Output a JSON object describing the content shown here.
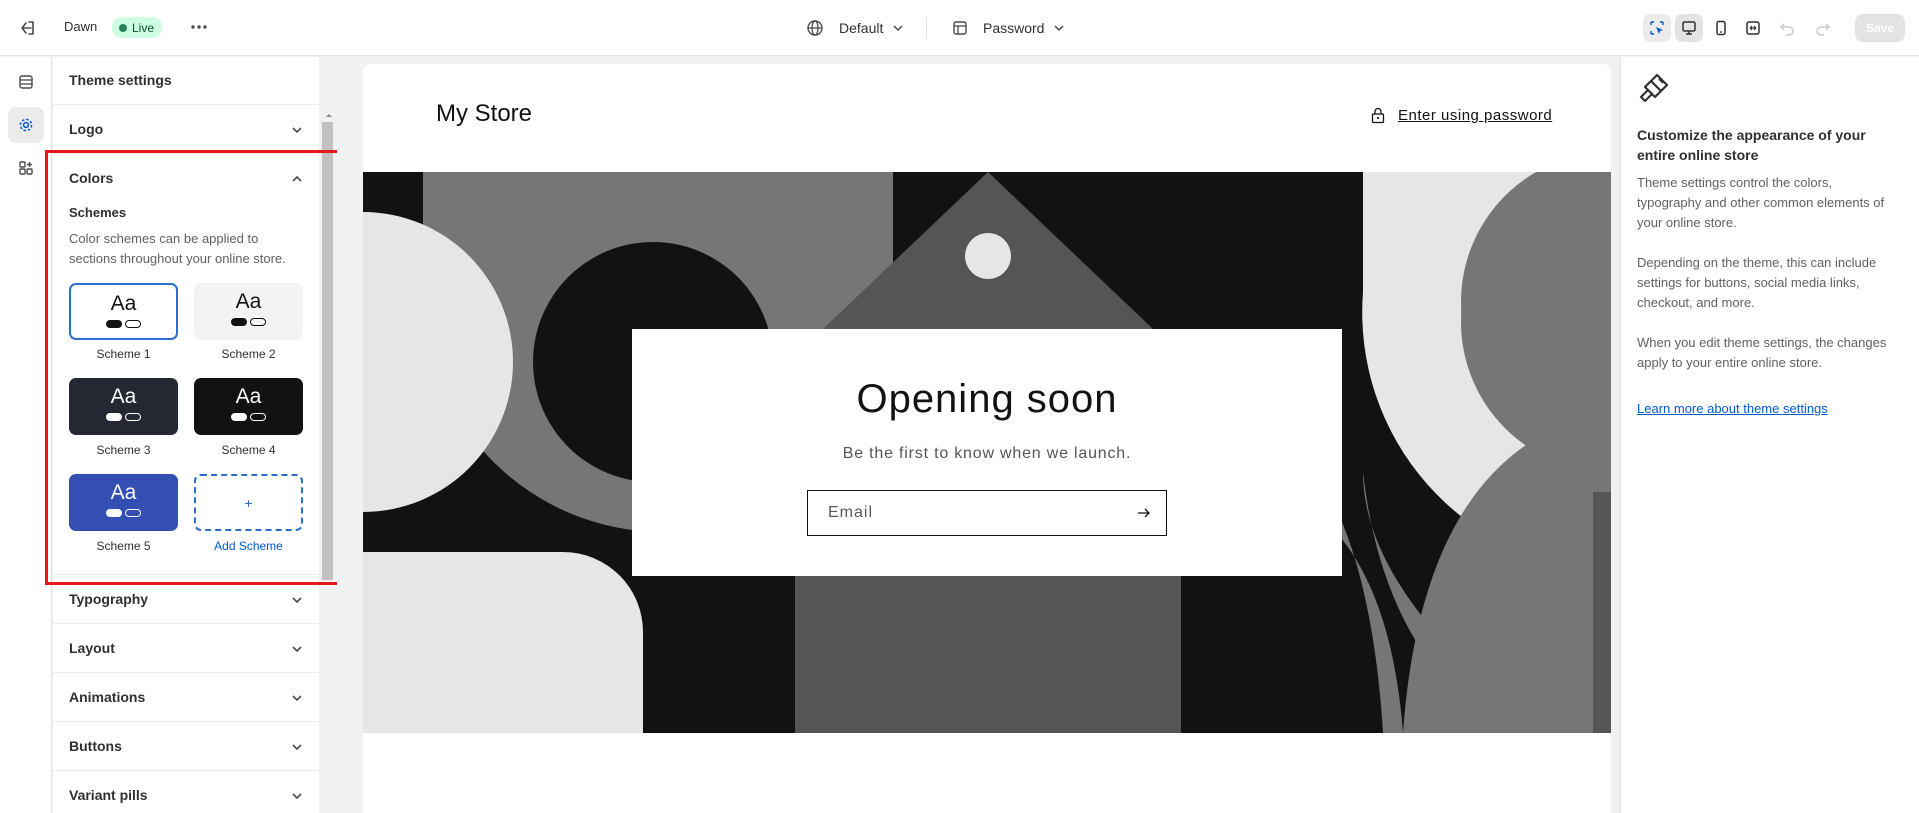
{
  "topbar": {
    "theme_name": "Dawn",
    "status": "Live",
    "template_select": "Default",
    "page_select": "Password",
    "save_label": "Save"
  },
  "sidebar": {
    "title": "Theme settings",
    "sections": {
      "logo": "Logo",
      "colors": "Colors",
      "typography": "Typography",
      "layout": "Layout",
      "animations": "Animations",
      "buttons": "Buttons",
      "variant_pills": "Variant pills"
    },
    "schemes_heading": "Schemes",
    "schemes_description": "Color schemes can be applied to sections throughout your online store.",
    "schemes": [
      {
        "label": "Scheme 1",
        "sample": "Aa",
        "bg": "#ffffff",
        "fg": "#121212"
      },
      {
        "label": "Scheme 2",
        "sample": "Aa",
        "bg": "#f3f3f3",
        "fg": "#121212"
      },
      {
        "label": "Scheme 3",
        "sample": "Aa",
        "bg": "#242833",
        "fg": "#ffffff"
      },
      {
        "label": "Scheme 4",
        "sample": "Aa",
        "bg": "#121212",
        "fg": "#ffffff"
      },
      {
        "label": "Scheme 5",
        "sample": "Aa",
        "bg": "#334fb4",
        "fg": "#ffffff"
      }
    ],
    "add_scheme_icon": "+",
    "add_scheme_label": "Add Scheme"
  },
  "preview": {
    "store_name": "My Store",
    "enter_password": "Enter using password",
    "hero_title": "Opening soon",
    "hero_subtitle": "Be the first to know when we launch.",
    "email_placeholder": "Email"
  },
  "info_panel": {
    "heading": "Customize the appearance of your entire online store",
    "para1": "Theme settings control the colors, typography and other common elements of your online store.",
    "para2": "Depending on the theme, this can include settings for buttons, social media links, checkout, and more.",
    "para3": "When you edit theme settings, the changes apply to your entire online store.",
    "link": "Learn more about theme settings"
  },
  "colors": {
    "accent": "#005bd3",
    "highlight": "#e5161d",
    "live_bg": "#cdfee1"
  }
}
